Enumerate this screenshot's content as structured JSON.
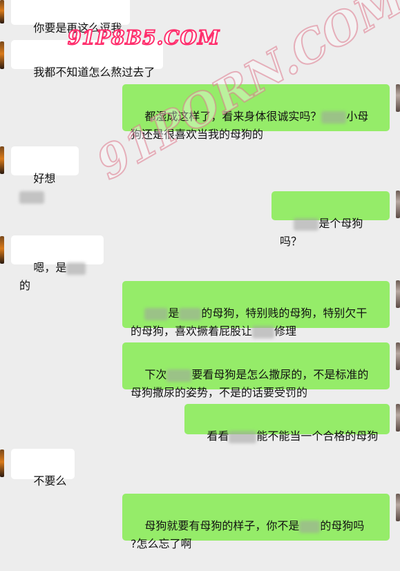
{
  "watermarks": {
    "top": "91P8B5.COM",
    "diagonal": "91PORN.COM"
  },
  "messages": [
    {
      "side": "in",
      "text": "你要是再这么逗我"
    },
    {
      "side": "in",
      "text": "我都不知道怎么熬过去了"
    },
    {
      "side": "out",
      "line1": "都湿成这样了，看来身体很诚实吗？",
      "line1_tail": "小母",
      "line2": "狗还是很喜欢当我的母狗的"
    },
    {
      "side": "in",
      "text": "好想"
    },
    {
      "side": "out",
      "text": "是个母狗吗？"
    },
    {
      "side": "in",
      "pre": "嗯，是",
      "post": "的"
    },
    {
      "side": "out",
      "line1a": "是",
      "line1b": "的母狗，特别贱的母狗，特别欠干",
      "line2a": "的母狗，喜欢撅着屁股让",
      "line2b": "修理"
    },
    {
      "side": "out",
      "line1a": "下次",
      "line1b": "要看母狗是怎么撒尿的，不是标准的",
      "line2": "母狗撒尿的姿势，不是的话要受罚的"
    },
    {
      "side": "out",
      "pre": "看看",
      "post": "能不能当一个合格的母狗"
    },
    {
      "side": "in",
      "text": "不要么"
    },
    {
      "side": "out",
      "line1a": "母狗就要有母狗的样子，你不是",
      "line1b": "的母狗吗",
      "line2": "?怎么忘了啊"
    }
  ]
}
